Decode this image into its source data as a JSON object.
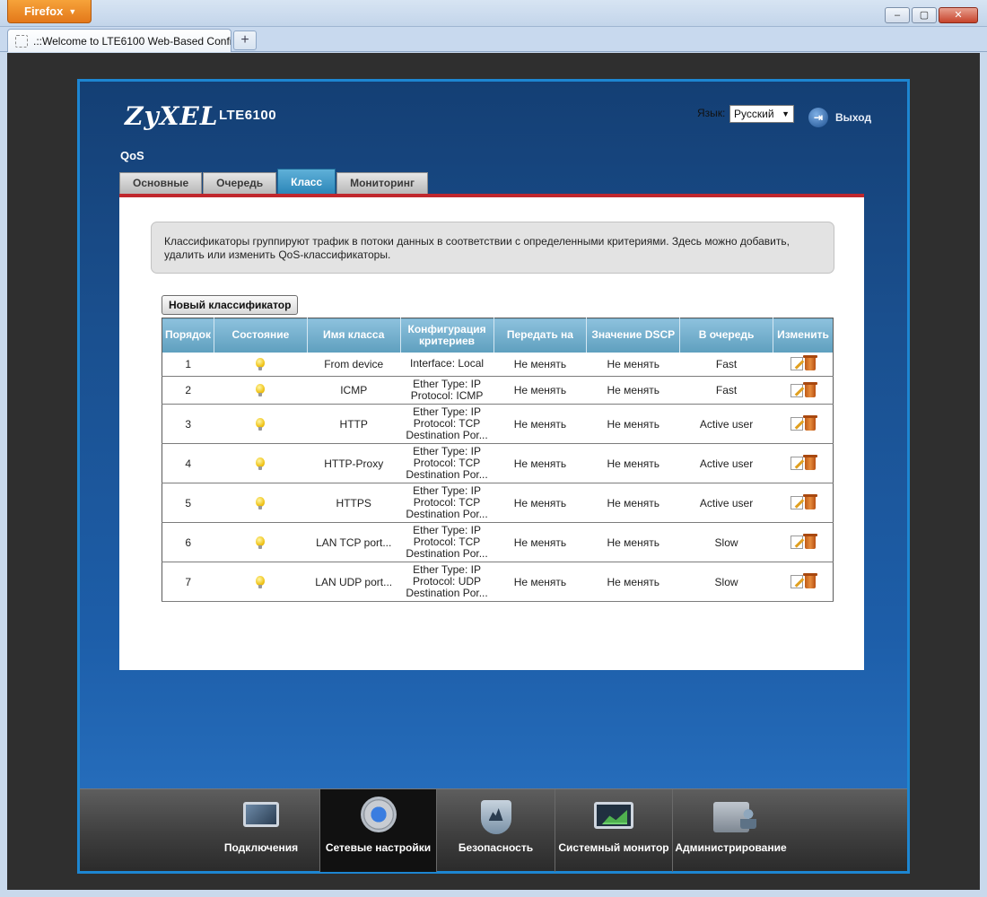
{
  "browser": {
    "app_button": "Firefox",
    "tab_title": ".::Welcome to LTE6100 Web-Based Confi...",
    "new_tab": "+",
    "window_buttons": {
      "minimize": "–",
      "maximize": "▢",
      "close": "✕"
    }
  },
  "header": {
    "logo": "ZyXEL",
    "model": "LTE6100",
    "language_label": "Язык:",
    "language_value": "Русский",
    "logout_label": "Выход"
  },
  "page": {
    "title": "QoS",
    "tabs": [
      {
        "label": "Основные",
        "active": false
      },
      {
        "label": "Очередь",
        "active": false
      },
      {
        "label": "Класс",
        "active": true
      },
      {
        "label": "Мониторинг",
        "active": false
      }
    ],
    "info_text": "Классификаторы группируют трафик в потоки данных в соответствии с определенными критериями. Здесь можно добавить, удалить или изменить QoS-классификаторы.",
    "new_button": "Новый классификатор"
  },
  "table": {
    "headers": [
      "Порядок",
      "Состояние",
      "Имя класса",
      "Конфигурация критериев",
      "Передать на",
      "Значение DSCP",
      "В очередь",
      "Изменить"
    ],
    "rows": [
      {
        "order": "1",
        "name": "From device",
        "criteria": [
          "Interface: Local"
        ],
        "forward": "Не менять",
        "dscp": "Не менять",
        "queue": "Fast"
      },
      {
        "order": "2",
        "name": "ICMP",
        "criteria": [
          "Ether Type: IP",
          "Protocol: ICMP"
        ],
        "forward": "Не менять",
        "dscp": "Не менять",
        "queue": "Fast"
      },
      {
        "order": "3",
        "name": "HTTP",
        "criteria": [
          "Ether Type: IP",
          "Protocol: TCP",
          "Destination Por..."
        ],
        "forward": "Не менять",
        "dscp": "Не менять",
        "queue": "Active user"
      },
      {
        "order": "4",
        "name": "HTTP-Proxy",
        "criteria": [
          "Ether Type: IP",
          "Protocol: TCP",
          "Destination Por..."
        ],
        "forward": "Не менять",
        "dscp": "Не менять",
        "queue": "Active user"
      },
      {
        "order": "5",
        "name": "HTTPS",
        "criteria": [
          "Ether Type: IP",
          "Protocol: TCP",
          "Destination Por..."
        ],
        "forward": "Не менять",
        "dscp": "Не менять",
        "queue": "Active user"
      },
      {
        "order": "6",
        "name": "LAN TCP port...",
        "criteria": [
          "Ether Type: IP",
          "Protocol: TCP",
          "Destination Por..."
        ],
        "forward": "Не менять",
        "dscp": "Не менять",
        "queue": "Slow"
      },
      {
        "order": "7",
        "name": "LAN UDP port...",
        "criteria": [
          "Ether Type: IP",
          "Protocol: UDP",
          "Destination Por..."
        ],
        "forward": "Не менять",
        "dscp": "Не менять",
        "queue": "Slow"
      }
    ],
    "status_icon": "bulb-icon",
    "edit_icon": "edit-icon",
    "delete_icon": "trash-icon"
  },
  "bottom_nav": [
    {
      "label": "Подключения",
      "icon": "network-monitor-icon",
      "active": false
    },
    {
      "label": "Сетевые настройки",
      "icon": "gear-icon",
      "active": true
    },
    {
      "label": "Безопасность",
      "icon": "shield-icon",
      "active": false
    },
    {
      "label": "Системный монитор",
      "icon": "chart-monitor-icon",
      "active": false
    },
    {
      "label": "Администрирование",
      "icon": "admin-icon",
      "active": false
    }
  ],
  "colors": {
    "accent_red": "#c0272d",
    "tab_active": "#2c86b8",
    "table_header": "#5e9fbe",
    "page_bg": "#1a4f8e"
  }
}
